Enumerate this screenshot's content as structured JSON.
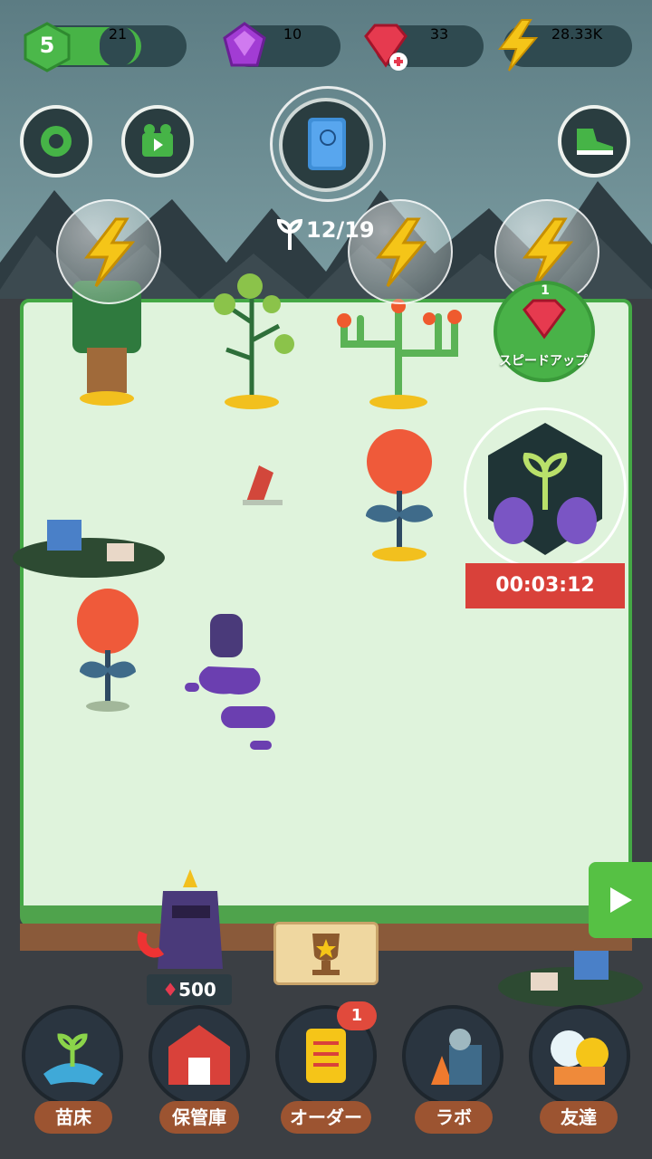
{
  "top_bar": {
    "level": "5",
    "level_progress": "21",
    "purple_gems": "10",
    "red_gems": "33",
    "energy": "28.33K"
  },
  "center": {
    "sprout_count": "12/19"
  },
  "speed_up": {
    "count": "1",
    "label": "スピードアップ"
  },
  "timer": {
    "value": "00:03:12"
  },
  "shop": {
    "price": "500"
  },
  "nav": [
    {
      "label": "苗床",
      "icon": "seedling-icon"
    },
    {
      "label": "保管庫",
      "icon": "barn-icon"
    },
    {
      "label": "オーダー",
      "icon": "scroll-icon",
      "badge": "1"
    },
    {
      "label": "ラボ",
      "icon": "lab-icon"
    },
    {
      "label": "友達",
      "icon": "friends-icon"
    }
  ],
  "colors": {
    "accent_green": "#47b346",
    "ribbon_red": "#d9413a",
    "nav_label_brown": "#9c5431"
  }
}
